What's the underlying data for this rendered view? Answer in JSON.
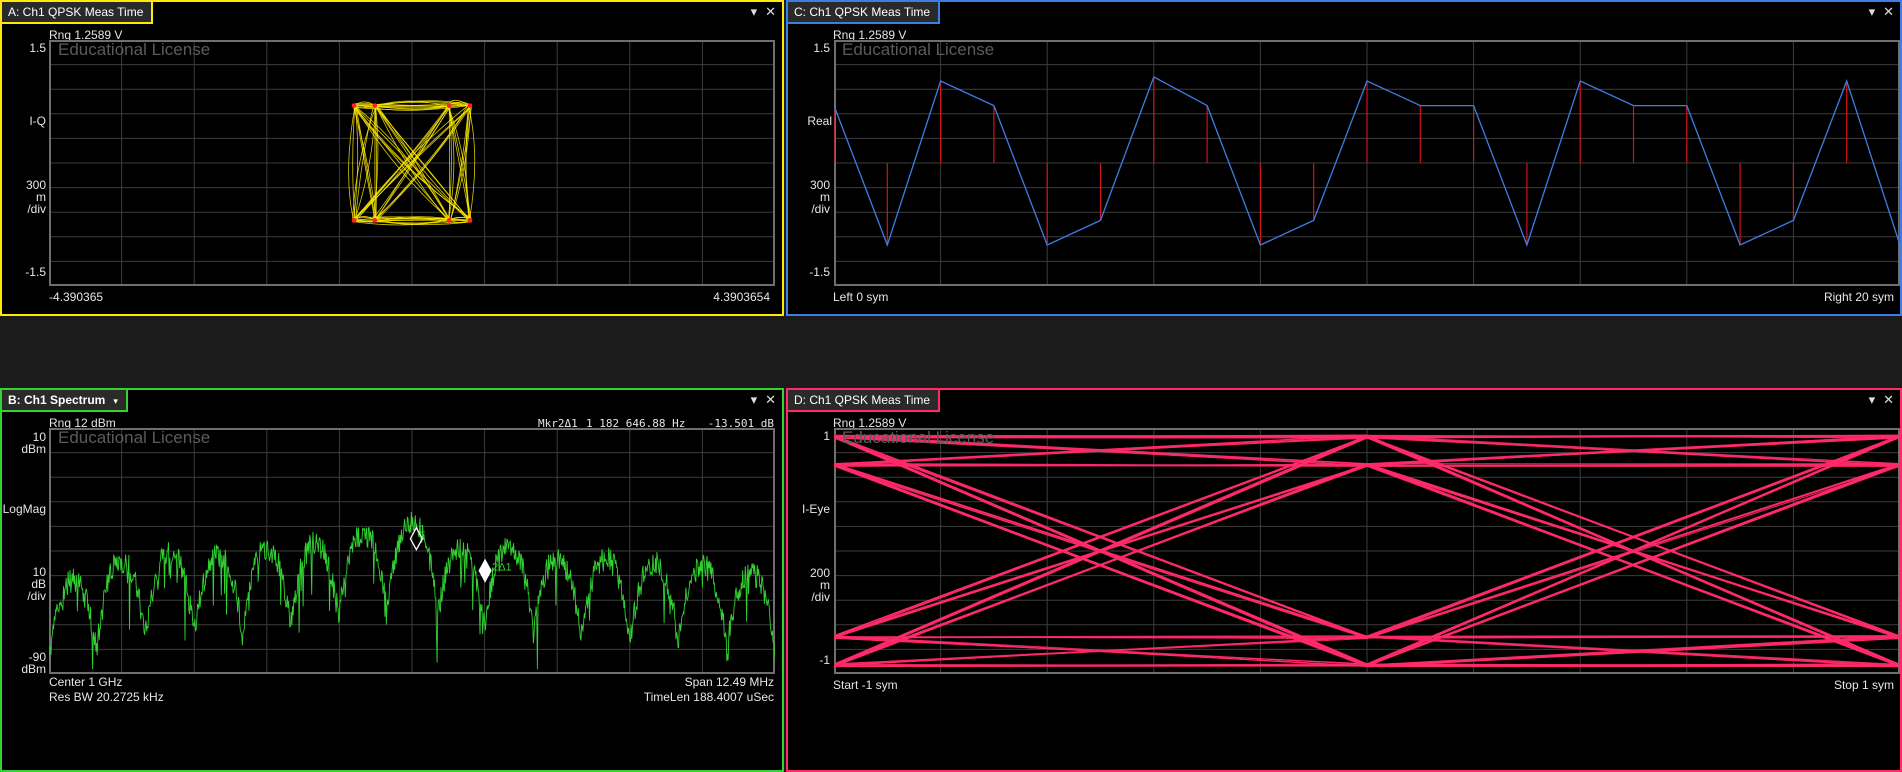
{
  "colors": {
    "A": "#ffeb00",
    "B": "#32d232",
    "C": "#3d7ee6",
    "D": "#ff2a6a",
    "grid": "#3c3c3c",
    "frame": "#6f6f6f",
    "stem": "#d21414"
  },
  "controls": {
    "dropdown_icon": "▾",
    "close_icon": "✕"
  },
  "watermark": "Educational License",
  "paneA": {
    "title": "A: Ch1 QPSK Meas Time",
    "range": "Rng 1.2589  V",
    "y_top": "1.5",
    "y_name": "I-Q",
    "y_div_1": "300",
    "y_div_2": "m",
    "y_div_3": "/div",
    "y_bottom": "-1.5",
    "x_left": "-4.390365",
    "x_right": "4.3903654"
  },
  "paneB": {
    "title": "B: Ch1 Spectrum",
    "range": "Rng 12 dBm",
    "marker_readout_name": "Mkr2Δ1",
    "marker_readout_value": "1 182 646.88 Hz",
    "marker_readout_level": "-13.501  dB",
    "y_top_1": "10",
    "y_top_2": "dBm",
    "y_name": "LogMag",
    "y_div_1": "10",
    "y_div_2": "dB",
    "y_div_3": "/div",
    "y_bottom_1": "-90",
    "y_bottom_2": "dBm",
    "center": "Center 1 GHz",
    "span": "Span 12.49 MHz",
    "res_bw": "Res BW 20.2725 kHz",
    "time_len": "TimeLen 188.4007 uSec",
    "marker1_label": "1",
    "marker2_label": "2Δ1"
  },
  "paneC": {
    "title": "C: Ch1 QPSK Meas Time",
    "range": "Rng 1.2589  V",
    "y_top": "1.5",
    "y_name": "Real",
    "y_div_1": "300",
    "y_div_2": "m",
    "y_div_3": "/div",
    "y_bottom": "-1.5",
    "x_left": "Left 0  sym",
    "x_right": "Right 20  sym"
  },
  "paneD": {
    "title": "D: Ch1 QPSK Meas Time",
    "range": "Rng 1.2589  V",
    "y_top": "1",
    "y_name": "I-Eye",
    "y_div_1": "200",
    "y_div_2": "m",
    "y_div_3": "/div",
    "y_bottom": "-1",
    "x_left": "Start -1  sym",
    "x_right": "Stop 1  sym"
  },
  "chart_data": [
    {
      "type": "scatter",
      "pane": "A",
      "description_series": "I-Q constellation",
      "x": [
        -0.7,
        -0.7,
        0.7,
        0.7,
        -0.45,
        -0.45,
        0.45,
        0.45
      ],
      "y": [
        -0.7,
        0.7,
        -0.7,
        0.7,
        -0.7,
        0.7,
        -0.7,
        0.7
      ],
      "ylim": [
        -1.5,
        1.5
      ],
      "xlim": [
        -4.390365,
        4.3903654
      ]
    },
    {
      "type": "line",
      "pane": "B",
      "ylabel": "LogMag",
      "ylim": [
        -90,
        10
      ],
      "center_hz": 1000000000,
      "span_hz": 12490000,
      "envelope_peak_dbm": -19,
      "lobe_peaks_dbm": [
        -43,
        -35,
        -32,
        -33,
        -30,
        -28,
        -24,
        -19,
        -30,
        -29,
        -34,
        -34,
        -36,
        -37,
        -40
      ],
      "marker_delta_hz": 1182646.88,
      "marker_delta_db": -13.501
    },
    {
      "type": "line",
      "pane": "C",
      "ylabel": "Real",
      "ylim": [
        -1.5,
        1.5
      ],
      "xlim": [
        0,
        20
      ],
      "x": [
        0,
        1,
        2,
        3,
        4,
        5,
        6,
        7,
        8,
        9,
        10,
        11,
        12,
        13,
        14,
        15,
        16,
        17,
        18,
        19,
        20
      ],
      "values": [
        0.7,
        -1.0,
        1.0,
        0.7,
        -1.0,
        -0.7,
        1.05,
        0.7,
        -1.0,
        -0.7,
        1.0,
        0.7,
        0.7,
        -1.0,
        1.0,
        0.7,
        0.7,
        -1.0,
        -0.7,
        1.0,
        -1.0
      ]
    },
    {
      "type": "line",
      "pane": "D",
      "ylabel": "I-Eye",
      "ylim": [
        -1,
        1
      ],
      "xlim": [
        -1,
        1
      ],
      "levels": [
        0.93,
        0.7,
        -0.7,
        -0.93
      ]
    }
  ]
}
